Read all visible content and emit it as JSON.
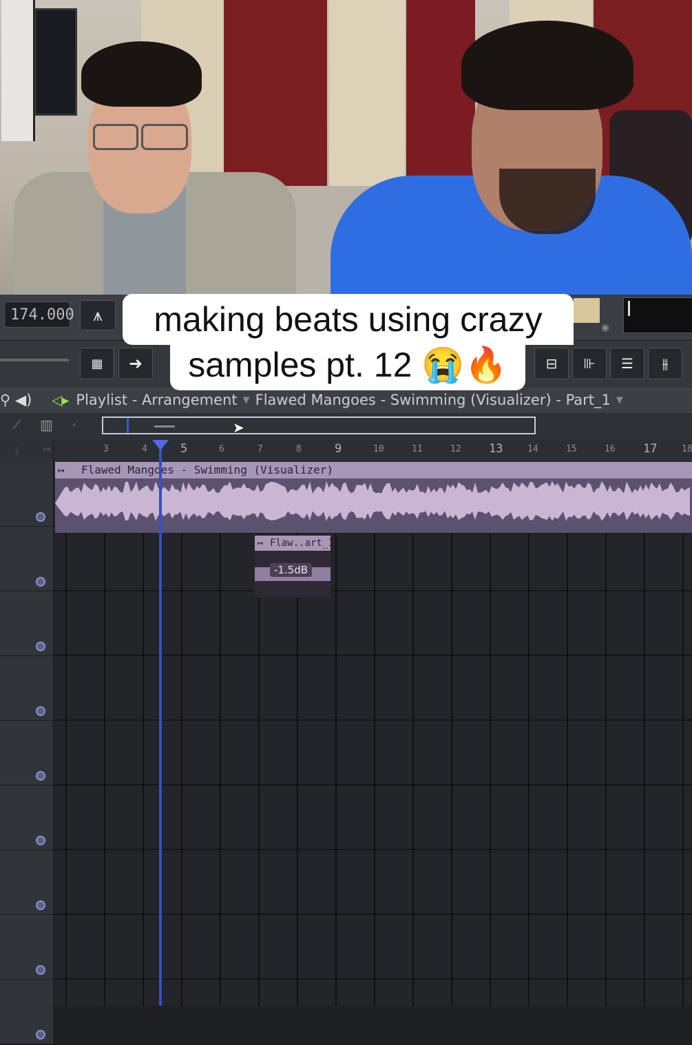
{
  "caption": {
    "line1": "making beats using crazy",
    "line2": "samples pt. 12 😭🔥"
  },
  "toolbar": {
    "tempo": "174.000"
  },
  "playlist": {
    "title_parts": [
      "Playlist - Arrangement",
      "Flawed Mangoes - Swimming (Visualizer) - Part_1"
    ]
  },
  "ruler": {
    "labels": [
      "3",
      "4",
      "5",
      "6",
      "7",
      "8",
      "9",
      "10",
      "11",
      "12",
      "13",
      "14",
      "15",
      "16",
      "17",
      "18"
    ]
  },
  "clips": {
    "main_name": "Flawed Mangoes - Swimming (Visualizer)",
    "small_name": "Flaw..art_1",
    "small_gain": "-1.5dB"
  }
}
